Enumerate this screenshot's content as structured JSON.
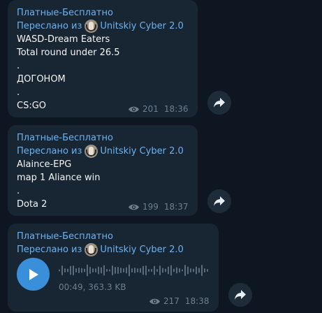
{
  "colors": {
    "background": "#0e1621",
    "bubble": "#182533",
    "accent": "#6ab3f3",
    "meta": "#6d7f8f",
    "play_button": "#3a8fdb"
  },
  "messages": [
    {
      "channel": "Платные-Бесплатно",
      "forwarded_prefix": "Переслано из",
      "forwarded_source": "Unitskiy Cyber 2.0",
      "lines": [
        "WASD-Dream Eaters",
        "Total round under 26.5",
        ".",
        "ДОГОНОМ",
        ".",
        "CS:GO"
      ],
      "views": "201",
      "time": "18:36"
    },
    {
      "channel": "Платные-Бесплатно",
      "forwarded_prefix": "Переслано из",
      "forwarded_source": "Unitskiy Cyber 2.0",
      "lines": [
        "Alaince-EPG",
        "map 1 Aliance win",
        ".",
        "Dota 2"
      ],
      "views": "199",
      "time": "18:37"
    },
    {
      "channel": "Платные-Бесплатно",
      "forwarded_prefix": "Переслано из",
      "forwarded_source": "Unitskiy Cyber 2.0",
      "voice": {
        "duration": "00:49",
        "size": "363.3 KB"
      },
      "views": "217",
      "time": "18:38"
    }
  ],
  "icons": {
    "views": "eye-icon",
    "share": "share-arrow-icon",
    "play": "play-icon",
    "avatar": "channel-avatar"
  }
}
